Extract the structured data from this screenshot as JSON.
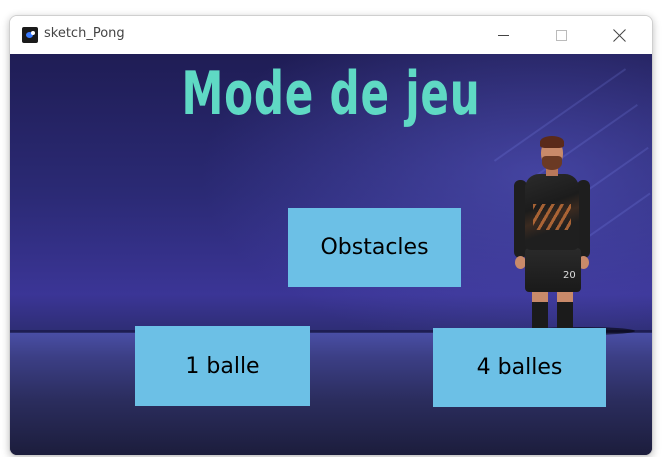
{
  "window": {
    "title": "sketch_Pong",
    "app_icon": "processing-app-icon",
    "controls": [
      "minimize-icon",
      "maximize-icon",
      "close-icon"
    ]
  },
  "canvas": {
    "heading": "Mode de jeu",
    "heading_color": "#5fd9c4",
    "button_color": "#6cc0e6",
    "buttons": {
      "obstacles": "Obstacles",
      "one_ball": "1 balle",
      "four_balls": "4 balles"
    },
    "player_number": "20"
  }
}
